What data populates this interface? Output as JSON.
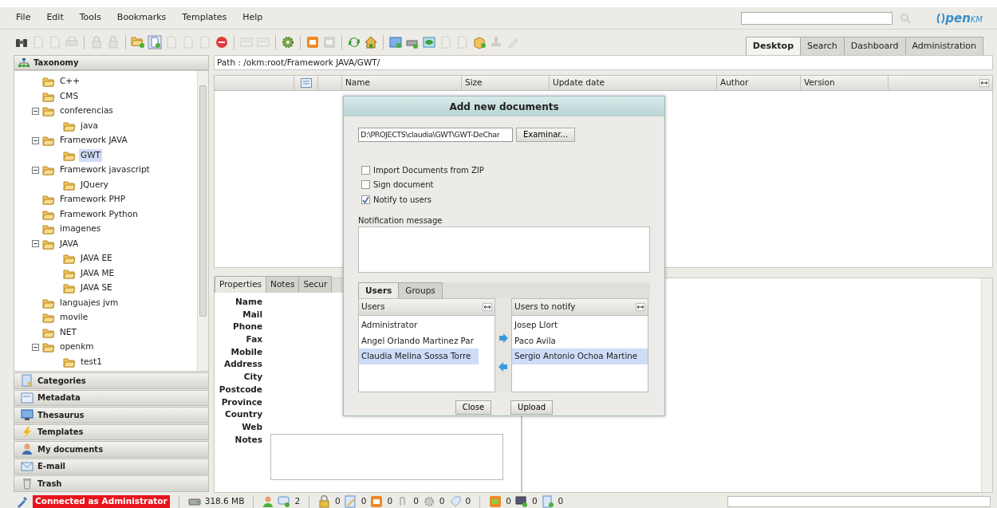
{
  "menu": [
    "File",
    "Edit",
    "Tools",
    "Bookmarks",
    "Templates",
    "Help"
  ],
  "logo": {
    "text": "pen",
    "suffix": "KM"
  },
  "toolbar": [
    [
      {
        "disabled": false
      },
      {
        "disabled": true
      },
      {
        "disabled": true
      },
      {
        "disabled": true
      }
    ],
    [
      {
        "disabled": true
      },
      {
        "disabled": true
      }
    ],
    [
      {
        "disabled": false
      },
      {
        "disabled": false
      },
      {
        "disabled": true
      },
      {
        "disabled": true
      },
      {
        "disabled": true
      },
      {
        "disabled": false
      }
    ],
    [
      {
        "disabled": true
      },
      {
        "disabled": true
      }
    ],
    [
      {
        "disabled": false
      }
    ],
    [
      {
        "disabled": false
      },
      {
        "disabled": true
      }
    ],
    [
      {
        "disabled": false
      },
      {
        "disabled": false
      }
    ],
    [
      {
        "disabled": false
      },
      {
        "disabled": false
      },
      {
        "disabled": false
      },
      {
        "disabled": true
      },
      {
        "disabled": true
      },
      {
        "disabled": false
      },
      {
        "disabled": true
      },
      {
        "disabled": true
      }
    ]
  ],
  "main_tabs": [
    {
      "label": "Desktop",
      "selected": true
    },
    {
      "label": "Search",
      "selected": false
    },
    {
      "label": "Dashboard",
      "selected": false
    },
    {
      "label": "Administration",
      "selected": false
    }
  ],
  "navigator": {
    "title": "Taxonomy",
    "tree": [
      {
        "label": "C++",
        "selected": false
      },
      {
        "label": "CMS",
        "selected": false
      },
      {
        "label": "conferencias",
        "selected": false,
        "expanded": true,
        "children": [
          {
            "label": "java",
            "selected": false
          }
        ]
      },
      {
        "label": "Framework JAVA",
        "selected": false,
        "expanded": true,
        "children": [
          {
            "label": "GWT",
            "selected": true
          }
        ]
      },
      {
        "label": "Framework javascript",
        "selected": false,
        "expanded": true,
        "children": [
          {
            "label": "JQuery",
            "selected": false
          }
        ]
      },
      {
        "label": "Framework PHP",
        "selected": false
      },
      {
        "label": "Framework Python",
        "selected": false
      },
      {
        "label": "imagenes",
        "selected": false
      },
      {
        "label": "JAVA",
        "selected": false,
        "expanded": true,
        "children": [
          {
            "label": "JAVA EE",
            "selected": false
          },
          {
            "label": "JAVA ME",
            "selected": false
          },
          {
            "label": "JAVA SE",
            "selected": false
          }
        ]
      },
      {
        "label": "languajes jvm",
        "selected": false
      },
      {
        "label": "movile",
        "selected": false
      },
      {
        "label": "NET",
        "selected": false
      },
      {
        "label": "openkm",
        "selected": false,
        "expanded": true,
        "children": [
          {
            "label": "test1",
            "selected": false
          }
        ]
      }
    ]
  },
  "accordion": [
    "Categories",
    "Metadata",
    "Thesaurus",
    "Templates",
    "My documents",
    "E-mail",
    "Trash"
  ],
  "path": "Path : /okm:root/Framework JAVA/GWT/",
  "file_table": {
    "columns": [
      {
        "kind": "blank"
      },
      {
        "kind": "icon"
      },
      {
        "kind": "blank"
      },
      {
        "kind": "text",
        "label": "Name"
      },
      {
        "kind": "text",
        "label": "Size"
      },
      {
        "kind": "text",
        "label": "Update date"
      },
      {
        "kind": "text",
        "label": "Author"
      },
      {
        "kind": "text",
        "label": "Version"
      },
      {
        "kind": "resize"
      }
    ]
  },
  "properties": {
    "tabs": [
      {
        "label": "Properties",
        "selected": true
      },
      {
        "label": "Notes",
        "selected": false
      },
      {
        "label": "Secur",
        "selected": false
      }
    ],
    "fields": [
      "Name",
      "Mail",
      "Phone",
      "Fax",
      "Mobile",
      "Address",
      "City",
      "Postcode",
      "Province",
      "Country",
      "Web",
      "Notes"
    ]
  },
  "dialog": {
    "title": "Add new documents",
    "file_value": "D:\\PROJECTS\\claudia\\GWT\\GWT-DeChar",
    "browse_button": "Examinar...",
    "options": [
      {
        "label": "Import Documents from ZIP",
        "checked": false
      },
      {
        "label": "Sign document",
        "checked": false
      },
      {
        "label": "Notify to users",
        "checked": true
      }
    ],
    "message_label": "Notification message",
    "tabs": [
      {
        "label": "Users",
        "selected": true
      },
      {
        "label": "Groups",
        "selected": false
      }
    ],
    "available": {
      "header": "Users",
      "rows": [
        {
          "label": "Administrator",
          "selected": false
        },
        {
          "label": "Angel Orlando Martinez Par",
          "selected": false
        },
        {
          "label": "Claudia Melina Sossa Torre",
          "selected": true
        }
      ]
    },
    "notify": {
      "header": "Users to notify",
      "rows": [
        {
          "label": "Josep Llort",
          "selected": false
        },
        {
          "label": "Paco Avila",
          "selected": false
        },
        {
          "label": "Sergio Antonio Ochoa Martine",
          "selected": true
        }
      ]
    },
    "buttons": [
      "Close",
      "Upload"
    ]
  },
  "status_bar": {
    "connection": "Connected as Administrator",
    "memory": "318.6 MB",
    "counters": [
      "2",
      "0",
      "0",
      "0",
      "0",
      "0",
      "0",
      "0",
      "0",
      "0"
    ]
  }
}
